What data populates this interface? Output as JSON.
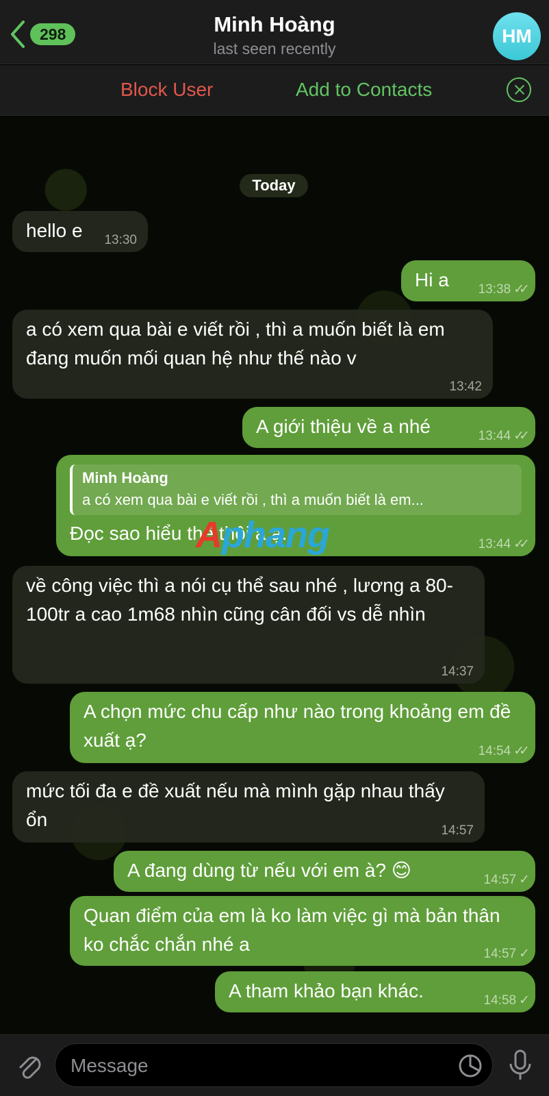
{
  "header": {
    "unread_count": "298",
    "title": "Minh Hoàng",
    "status": "last seen recently",
    "avatar_initials": "HM"
  },
  "action_bar": {
    "block_label": "Block User",
    "add_label": "Add to Contacts"
  },
  "date_chip": "Today",
  "messages": [
    {
      "dir": "in",
      "text": "hello e",
      "time": "13:30"
    },
    {
      "dir": "out",
      "text": "Hi a",
      "time": "13:38",
      "checks": "✓✓"
    },
    {
      "dir": "in",
      "text": "a có xem qua bài e viết rồi , thì a muốn biết là em đang muốn mối quan hệ như thế nào v",
      "time": "13:42"
    },
    {
      "dir": "out",
      "text": "A giới thiệu về a nhé",
      "time": "13:44",
      "checks": "✓✓"
    },
    {
      "dir": "out",
      "reply_name": "Minh Hoàng",
      "reply_text": "a có xem qua bài e viết rồi , thì a muốn biết là em...",
      "text": "Đọc sao hiểu thế thôi a ạ.",
      "time": "13:44",
      "checks": "✓✓"
    },
    {
      "dir": "in",
      "text": "về công việc thì a nói cụ thể sau nhé , lương a 80-100tr a cao 1m68 nhìn cũng cân đối vs dễ nhìn",
      "time": "14:37"
    },
    {
      "dir": "out",
      "text": "A chọn mức chu cấp như nào trong khoảng em đề xuất ạ?",
      "time": "14:54",
      "checks": "✓✓"
    },
    {
      "dir": "in",
      "text": "mức tối đa e đề xuất nếu mà mình gặp nhau thấy ổn",
      "time": "14:57"
    },
    {
      "dir": "out",
      "text": "A đang dùng từ nếu với em à? 😊",
      "time": "14:57",
      "checks": "✓"
    },
    {
      "dir": "out",
      "text": "Quan điểm của em là ko làm việc gì mà bản thân ko chắc chắn nhé a",
      "time": "14:57",
      "checks": "✓"
    },
    {
      "dir": "out",
      "text": "A tham khảo bạn khác.",
      "time": "14:58",
      "checks": "✓"
    }
  ],
  "watermark": {
    "part1": "A",
    "part2": "phang"
  },
  "composer": {
    "placeholder": "Message"
  },
  "colors": {
    "accent": "#62c462",
    "danger": "#e2574c",
    "outgoing": "#5f9e3a",
    "incoming": "#24281e"
  }
}
